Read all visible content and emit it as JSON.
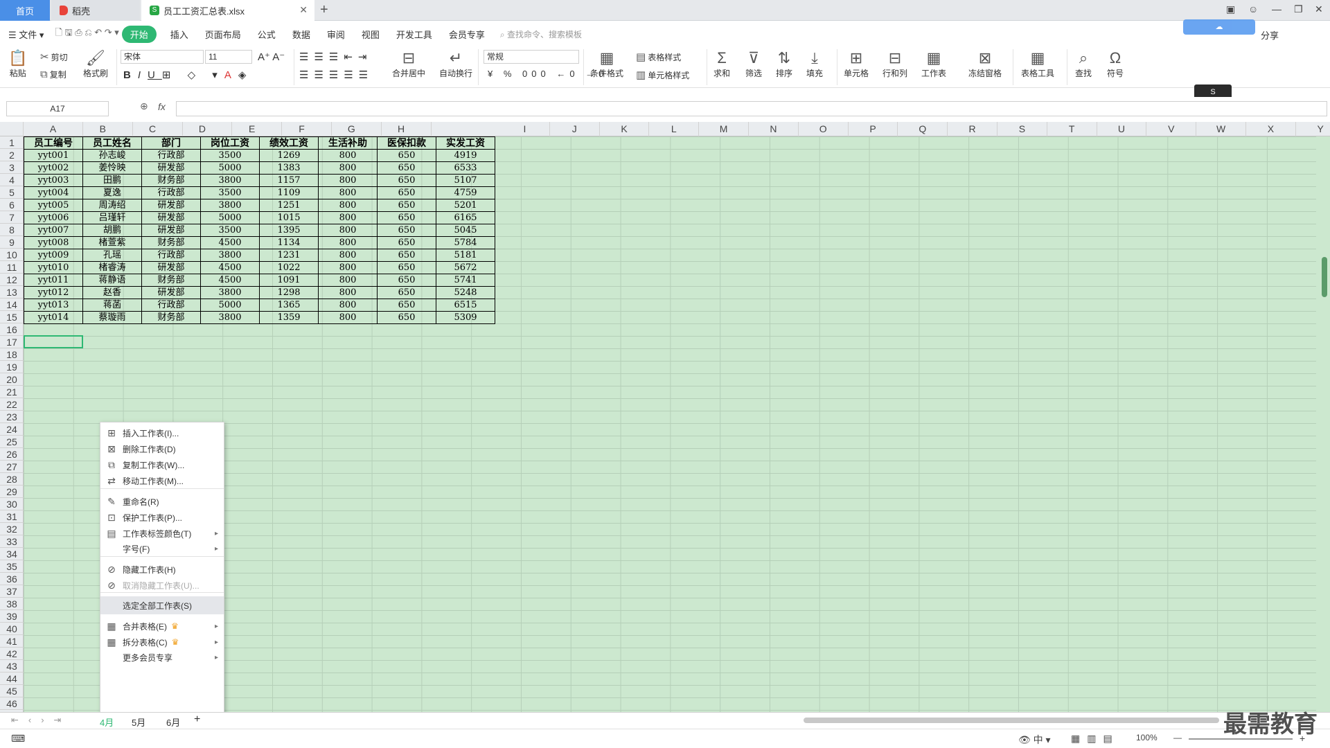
{
  "tabs": {
    "home": "首页",
    "dao": "稻壳",
    "file": "员工工资汇总表.xlsx"
  },
  "menubar": {
    "file": "文件",
    "items": [
      "开始",
      "插入",
      "页面布局",
      "公式",
      "数据",
      "审阅",
      "视图",
      "开发工具",
      "会员专享"
    ],
    "search_placeholder": "查找命令、搜索模板",
    "share": "分享"
  },
  "ribbon": {
    "paste": "粘贴",
    "cut": "剪切",
    "copy": "复制",
    "format_painter": "格式刷",
    "font_name": "宋体",
    "font_size": "11",
    "merge_center": "合并居中",
    "wrap_text": "自动换行",
    "number_format": "常规",
    "cond_format": "条件格式",
    "table_style": "表格样式",
    "cell_style": "单元格样式",
    "sum": "求和",
    "filter": "筛选",
    "sort": "排序",
    "fill": "填充",
    "cell": "单元格",
    "row_col": "行和列",
    "worksheet": "工作表",
    "freeze": "冻结窗格",
    "table_tools": "表格工具",
    "find": "查找",
    "symbol": "符号"
  },
  "formula": {
    "name_box": "A17",
    "fx": "fx",
    "value": ""
  },
  "ime": "S",
  "columns": [
    "A",
    "B",
    "C",
    "D",
    "E",
    "F",
    "G",
    "H",
    "I",
    "J",
    "K",
    "L",
    "M",
    "N",
    "O",
    "P",
    "Q",
    "R",
    "S",
    "T",
    "U",
    "V",
    "W",
    "X",
    "Y"
  ],
  "table": {
    "headers": [
      "员工编号",
      "员工姓名",
      "部门",
      "岗位工资",
      "绩效工资",
      "生活补助",
      "医保扣款",
      "实发工资"
    ],
    "rows": [
      [
        "yyt001",
        "孙志峻",
        "行政部",
        "3500",
        "1269",
        "800",
        "650",
        "4919"
      ],
      [
        "yyt002",
        "姜怜映",
        "研发部",
        "5000",
        "1383",
        "800",
        "650",
        "6533"
      ],
      [
        "yyt003",
        "田鹏",
        "财务部",
        "3800",
        "1157",
        "800",
        "650",
        "5107"
      ],
      [
        "yyt004",
        "夏逸",
        "行政部",
        "3500",
        "1109",
        "800",
        "650",
        "4759"
      ],
      [
        "yyt005",
        "周涛绍",
        "研发部",
        "3800",
        "1251",
        "800",
        "650",
        "5201"
      ],
      [
        "yyt006",
        "吕瑾轩",
        "研发部",
        "5000",
        "1015",
        "800",
        "650",
        "6165"
      ],
      [
        "yyt007",
        "胡鹏",
        "研发部",
        "3500",
        "1395",
        "800",
        "650",
        "5045"
      ],
      [
        "yyt008",
        "楮萱紫",
        "财务部",
        "4500",
        "1134",
        "800",
        "650",
        "5784"
      ],
      [
        "yyt009",
        "孔瑶",
        "行政部",
        "3800",
        "1231",
        "800",
        "650",
        "5181"
      ],
      [
        "yyt010",
        "楮睿涛",
        "研发部",
        "4500",
        "1022",
        "800",
        "650",
        "5672"
      ],
      [
        "yyt011",
        "蒋静语",
        "财务部",
        "4500",
        "1091",
        "800",
        "650",
        "5741"
      ],
      [
        "yyt012",
        "赵香",
        "研发部",
        "3800",
        "1298",
        "800",
        "650",
        "5248"
      ],
      [
        "yyt013",
        "蒋菡",
        "行政部",
        "5000",
        "1365",
        "800",
        "650",
        "6515"
      ],
      [
        "yyt014",
        "蔡璇雨",
        "财务部",
        "3800",
        "1359",
        "800",
        "650",
        "5309"
      ]
    ]
  },
  "context_menu": [
    {
      "label": "插入工作表(I)...",
      "icon": "insert-sheet-icon",
      "glyph": "⊞"
    },
    {
      "label": "删除工作表(D)",
      "icon": "delete-sheet-icon",
      "glyph": "⊠"
    },
    {
      "label": "复制工作表(W)...",
      "icon": "copy-sheet-icon",
      "glyph": "⧉"
    },
    {
      "label": "移动工作表(M)...",
      "icon": "move-sheet-icon",
      "glyph": "⇄"
    },
    {
      "label": "重命名(R)",
      "icon": "rename-icon",
      "glyph": "✎"
    },
    {
      "label": "保护工作表(P)...",
      "icon": "protect-sheet-icon",
      "glyph": "⊡"
    },
    {
      "label": "工作表标签颜色(T)",
      "icon": "tab-color-icon",
      "glyph": "▤"
    },
    {
      "label": "字号(F)",
      "icon": "",
      "glyph": ""
    },
    {
      "label": "隐藏工作表(H)",
      "icon": "hide-sheet-icon",
      "glyph": "⊘"
    },
    {
      "label": "取消隐藏工作表(U)...",
      "icon": "unhide-sheet-icon",
      "glyph": "⊘"
    },
    {
      "label": "选定全部工作表(S)",
      "icon": "",
      "glyph": ""
    },
    {
      "label": "合并表格(E)",
      "icon": "merge-table-icon",
      "glyph": "▦"
    },
    {
      "label": "拆分表格(C)",
      "icon": "split-table-icon",
      "glyph": "▦"
    },
    {
      "label": "更多会员专享",
      "icon": "",
      "glyph": ""
    }
  ],
  "sheet_tabs": [
    "4月",
    "5月",
    "6月"
  ],
  "status": {
    "zoom": "100%"
  },
  "watermark": "最需教育",
  "colors": {
    "accent": "#2eb873",
    "sheet_bg": "#cce8cf",
    "home_tab": "#4a8fe7"
  }
}
